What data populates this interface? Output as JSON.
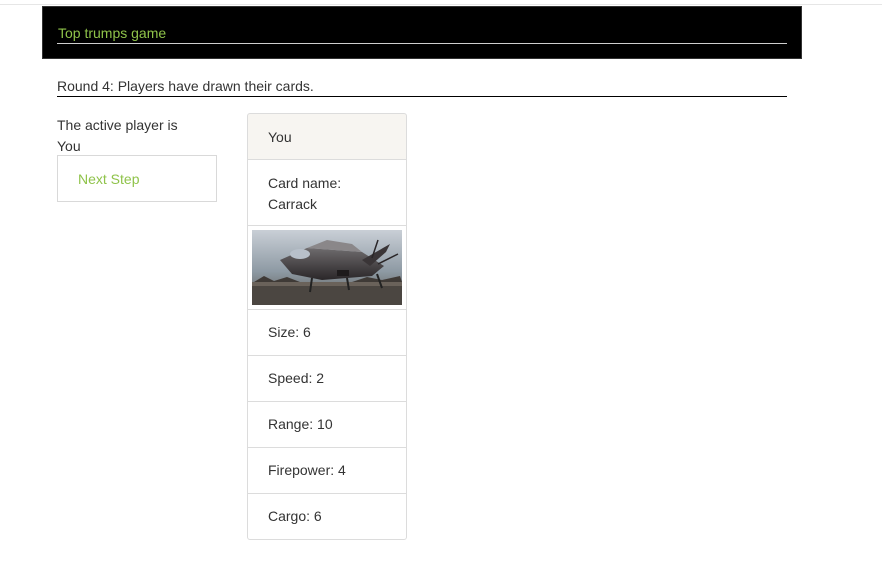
{
  "header": {
    "title": "Top trumps game"
  },
  "round": {
    "status": "Round 4: Players have drawn their cards."
  },
  "active_player": {
    "label": "The active player is",
    "name": "You"
  },
  "actions": {
    "next_step_label": "Next Step"
  },
  "card": {
    "owner": "You",
    "name_label": "Card name:",
    "name": "Carrack",
    "image_icon": "spaceship-image",
    "stats": [
      {
        "label": "Size: 6"
      },
      {
        "label": "Speed: 2"
      },
      {
        "label": "Range: 10"
      },
      {
        "label": "Firepower: 4"
      },
      {
        "label": "Cargo: 6"
      }
    ]
  },
  "colors": {
    "accent": "#8fc34a",
    "header_bg": "#000000",
    "card_header_bg": "#f7f5f1"
  }
}
